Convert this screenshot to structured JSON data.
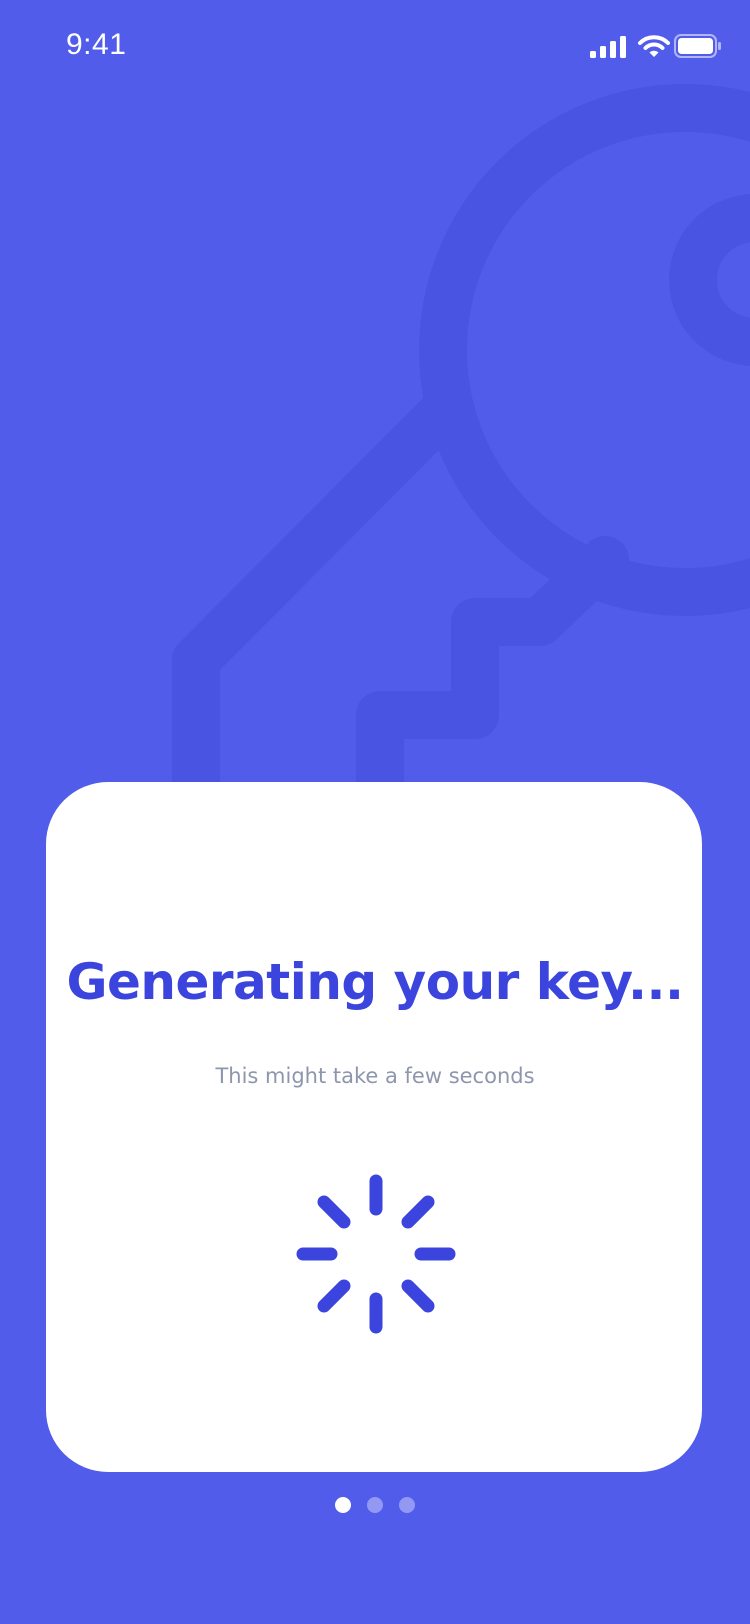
{
  "status_bar": {
    "time": "9:41",
    "icons": [
      "cellular-signal-icon",
      "wifi-icon",
      "battery-icon"
    ]
  },
  "background": {
    "icon": "key-icon"
  },
  "card": {
    "title": "Generating your key...",
    "subtitle": "This might take a few seconds",
    "loader_icon": "loading-spinner-icon"
  },
  "pager": {
    "page_count": 3,
    "active_index": 0
  },
  "colors": {
    "background": "#525CEB",
    "key_watermark": "#4A54E2",
    "card": "#FFFFFF",
    "accent": "#3B44DC",
    "subtitle": "#8E96AE",
    "dot_active": "#FFFFFF",
    "dot_inactive": "#9399F2"
  }
}
